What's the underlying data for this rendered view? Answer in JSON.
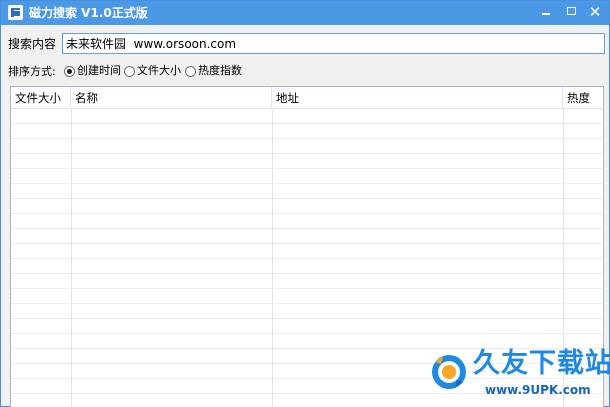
{
  "window": {
    "title": "磁力搜索 V1.0正式版",
    "controls": {
      "minimize": "minimize",
      "maximize": "maximize",
      "close": "✕"
    }
  },
  "search": {
    "label": "搜索内容",
    "value": "未来软件园  www.orsoon.com"
  },
  "sort": {
    "label": "排序方式:",
    "options": [
      {
        "label": "创建时间",
        "checked": true
      },
      {
        "label": "文件大小",
        "checked": false
      },
      {
        "label": "热度指数",
        "checked": false
      }
    ]
  },
  "table": {
    "columns": [
      "文件大小",
      "名称",
      "地址",
      "热度"
    ],
    "rows": []
  },
  "watermark": {
    "title": "久友下载站",
    "url": "www.9UPK.com"
  },
  "colors": {
    "titlebar": "#4a98e6",
    "watermark_blue": "#1e88e5"
  }
}
